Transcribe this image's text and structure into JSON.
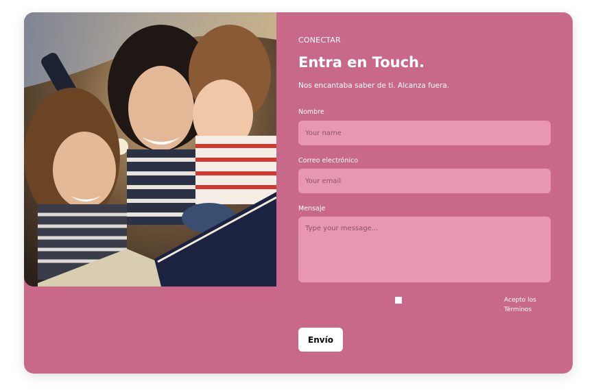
{
  "colors": {
    "card_background": "#c8698a",
    "field_background": "#e897b3",
    "button_background": "#ffffff"
  },
  "image": {
    "icon": "photo-family-reading-book"
  },
  "form": {
    "eyebrow": "CONECTAR",
    "title": "Entra en Touch.",
    "subtitle": "Nos encantaba saber de ti. Alcanza fuera.",
    "name_label": "Nombre",
    "name_placeholder": "Your name",
    "email_label": "Correo electrónico",
    "email_placeholder": "Your email",
    "message_label": "Mensaje",
    "message_placeholder": "Type your message...",
    "terms_label": "Acepto los Términos",
    "submit_label": "Envío"
  }
}
